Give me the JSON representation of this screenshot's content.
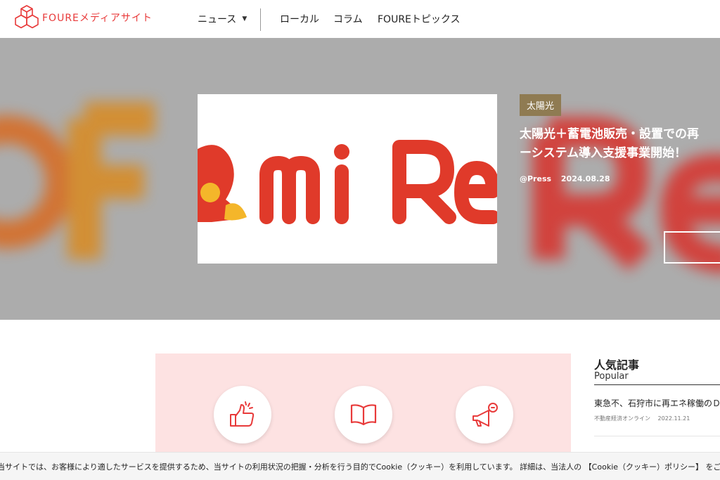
{
  "header": {
    "logo_text": "FOUREメディアサイト",
    "nav": {
      "news": "ニュース",
      "local": "ローカル",
      "column": "コラム",
      "topics": "FOUREトピックス"
    }
  },
  "hero": {
    "image_text": "mi Re",
    "tag": "太陽光",
    "title_line1": "太陽光＋蓄電池販売・設置での再",
    "title_line2": "ーシステム導入支援事業開始！",
    "source": "@Press",
    "date": "2024.08.28"
  },
  "popular": {
    "title": "人気記事",
    "subtitle": "Popular",
    "items": [
      {
        "title": "東急不、石狩市に再エネ稼働のＤＣ",
        "source": "不動産経済オンライン",
        "date": "2022.11.21"
      }
    ]
  },
  "feature_icons": [
    "thumbs-up-icon",
    "open-book-icon",
    "megaphone-icon"
  ],
  "cookie": {
    "text": "当サイトでは、お客様により適したサービスを提供するため、当サイトの利用状況の把握・分析を行う目的でCookie（クッキー）を利用しています。 詳細は、当法人の",
    "link": "【Cookie（クッキー）ポリシー】",
    "tail": "をご"
  },
  "colors": {
    "brand_red": "#e83a3a",
    "tag_bg": "#8f7b52",
    "hero_bg": "#acacac",
    "feature_bg": "#fde2e2"
  }
}
